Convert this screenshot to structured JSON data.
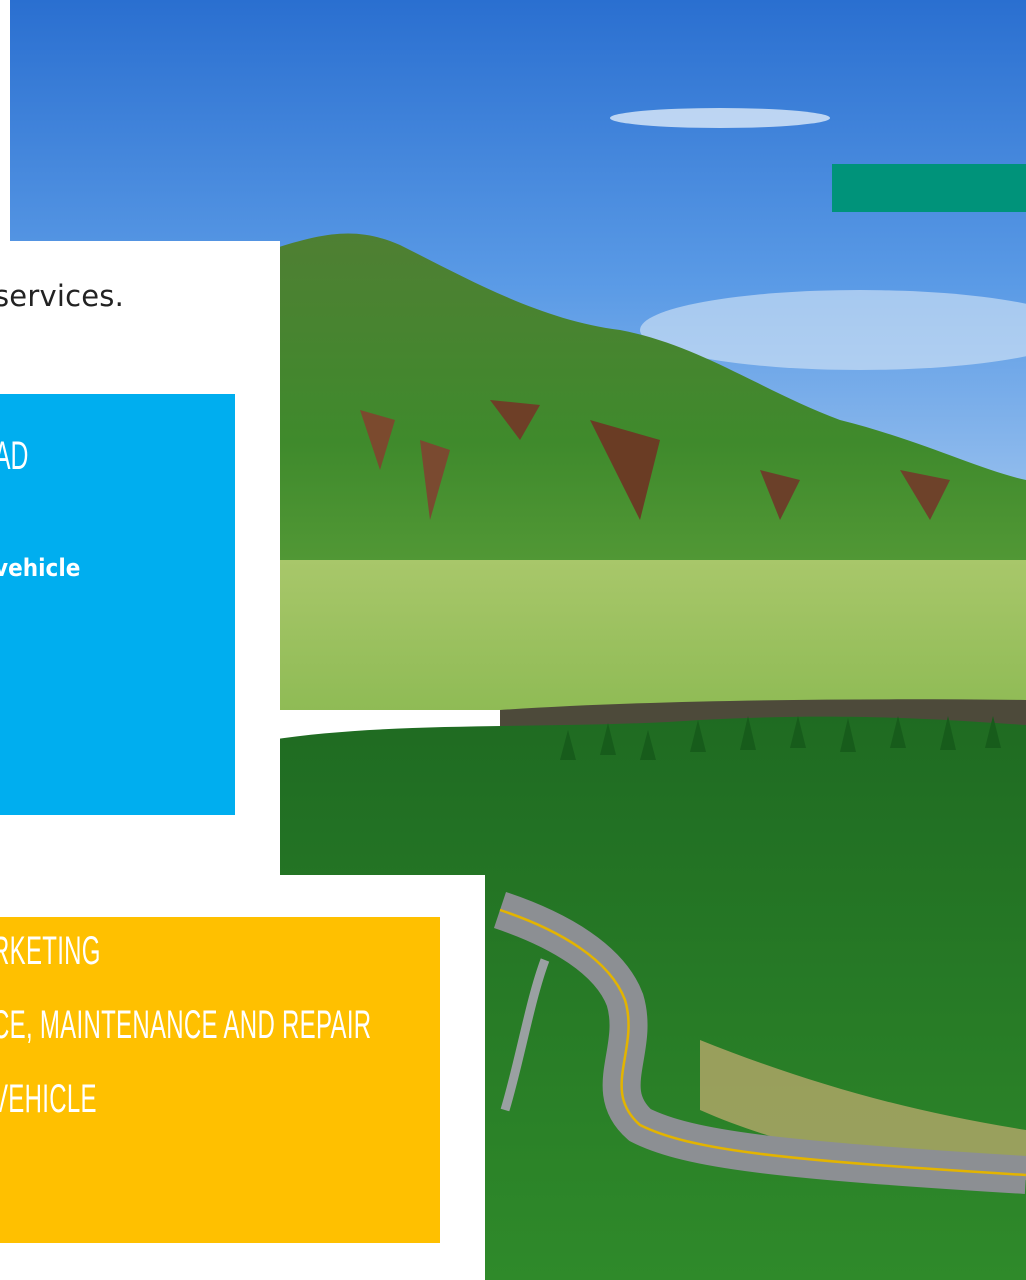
{
  "colors": {
    "teal": "#00937a",
    "blue": "#00aeef",
    "yellow": "#ffc000",
    "text_dark": "#222222",
    "text_light": "#ffffff"
  },
  "intro": {
    "text": "services."
  },
  "blue_card": {
    "heading": "AD",
    "subtext": "vehicle"
  },
  "yellow_card": {
    "items": [
      "RKETING",
      "CE, MAINTENANCE AND REPAIR",
      "VEHICLE"
    ]
  },
  "background": {
    "image": "mountain-valley-road-landscape"
  }
}
